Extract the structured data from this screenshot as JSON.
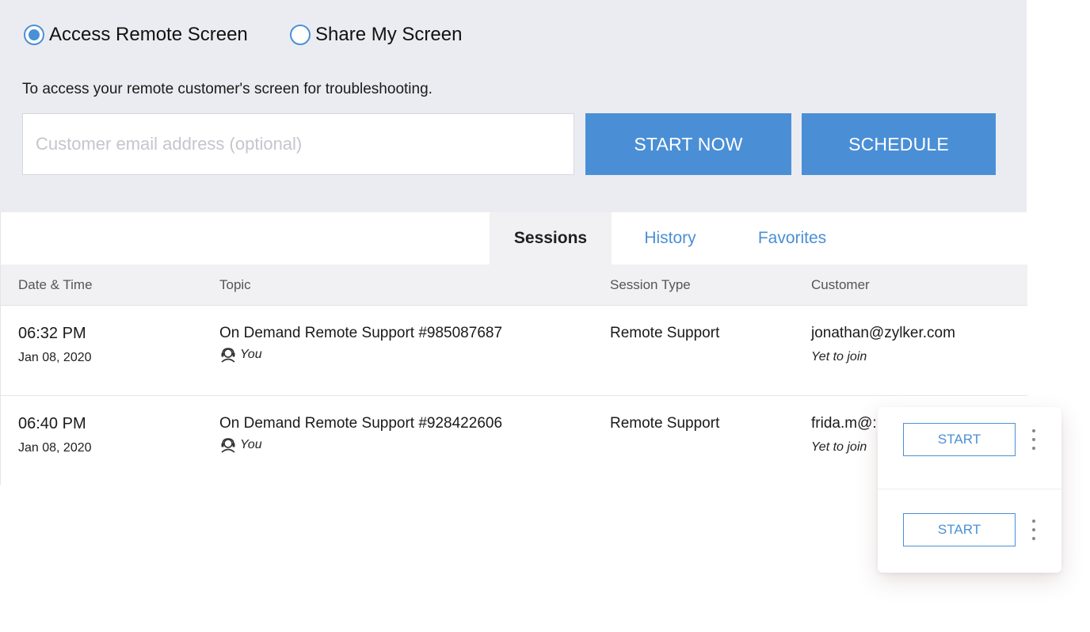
{
  "mode": {
    "options": [
      {
        "label": "Access Remote Screen",
        "selected": true
      },
      {
        "label": "Share My Screen",
        "selected": false
      }
    ]
  },
  "description": "To access your remote customer's screen for troubleshooting.",
  "email_input": {
    "placeholder": "Customer email address (optional)",
    "value": ""
  },
  "buttons": {
    "start_now": "START NOW",
    "schedule": "SCHEDULE"
  },
  "tabs": [
    {
      "label": "Sessions",
      "active": true
    },
    {
      "label": "History",
      "active": false
    },
    {
      "label": "Favorites",
      "active": false
    }
  ],
  "table": {
    "columns": [
      "Date & Time",
      "Topic",
      "Session Type",
      "Customer"
    ],
    "rows": [
      {
        "time": "06:32 PM",
        "date": "Jan 08, 2020",
        "topic": "On Demand Remote Support #985087687",
        "host": "You",
        "session_type": "Remote Support",
        "customer": "jonathan@zylker.com",
        "status": "Yet to join"
      },
      {
        "time": "06:40 PM",
        "date": "Jan 08, 2020",
        "topic": "On Demand Remote Support #928422606",
        "host": "You",
        "session_type": "Remote Support",
        "customer": "frida.m@:",
        "status": "Yet to join"
      }
    ]
  },
  "actions": {
    "start_label": "START"
  },
  "colors": {
    "accent": "#4a8fd6",
    "panel_bg": "#ebecf1",
    "header_bg": "#f1f1f3"
  },
  "icons": {
    "host": "user-headset-icon",
    "more": "kebab-menu-icon"
  }
}
